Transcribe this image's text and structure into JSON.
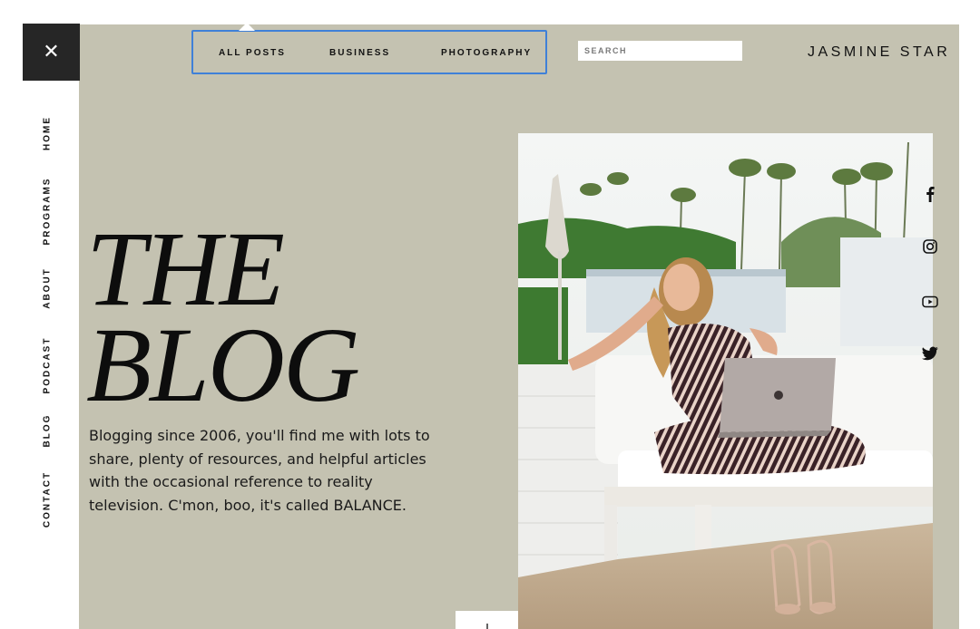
{
  "close": {
    "symbol": "✕"
  },
  "side_nav": {
    "items": [
      {
        "label": "HOME"
      },
      {
        "label": "PROGRAMS"
      },
      {
        "label": "ABOUT"
      },
      {
        "label": "PODCAST"
      },
      {
        "label": "BLOG"
      },
      {
        "label": "CONTACT"
      }
    ]
  },
  "top_nav": {
    "links": [
      {
        "label": "ALL POSTS"
      },
      {
        "label": "BUSINESS"
      },
      {
        "label": "PHOTOGRAPHY"
      }
    ]
  },
  "search": {
    "placeholder": "SEARCH"
  },
  "brand": {
    "name": "JASMINE STAR"
  },
  "hero": {
    "title_line1": "THE",
    "title_line2": "BLOG",
    "intro": "Blogging since 2006, you'll find me with lots to share, plenty of resources, and helpful articles with the occasional reference to reality television. C'mon, boo, it's called BALANCE."
  },
  "social": {
    "icons": [
      "facebook-icon",
      "instagram-icon",
      "youtube-icon",
      "twitter-icon"
    ]
  },
  "colors": {
    "panel_bg": "#c4c2b1",
    "sidebar_dark": "#262626",
    "nav_focus": "#3f80d8",
    "text": "#111111"
  }
}
